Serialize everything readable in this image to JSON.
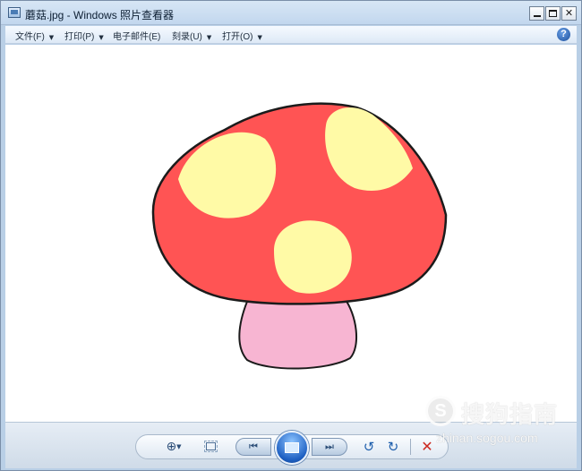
{
  "window": {
    "title": "蘑菇.jpg - Windows 照片查看器",
    "minimize_glyph": "",
    "maximize_glyph": "",
    "close_glyph": "✕"
  },
  "menu": {
    "items": [
      {
        "label": "文件(F)",
        "caret": "▼"
      },
      {
        "label": "打印(P)",
        "caret": "▼"
      },
      {
        "label": "电子邮件(E)",
        "caret": ""
      },
      {
        "label": "刻录(U)",
        "caret": "▼"
      },
      {
        "label": "打开(O)",
        "caret": "▼"
      }
    ],
    "help_glyph": "?"
  },
  "toolbar": {
    "zoom_glyph": "⊕",
    "zoom_caret": "▼",
    "prev_glyph": "⏮",
    "next_glyph": "⏭",
    "rotate_left_glyph": "↺",
    "rotate_right_glyph": "↻",
    "delete_glyph": "✕"
  },
  "image": {
    "subject": "mushroom",
    "colors": {
      "cap": "#ff5454",
      "spots": "#fffaa6",
      "stem": "#f7b5d2",
      "outline": "#1b1b1b"
    }
  },
  "watermark": {
    "brand": "搜狗指南",
    "url": "zhinan.sogou.com",
    "icon_glyph": "S"
  }
}
